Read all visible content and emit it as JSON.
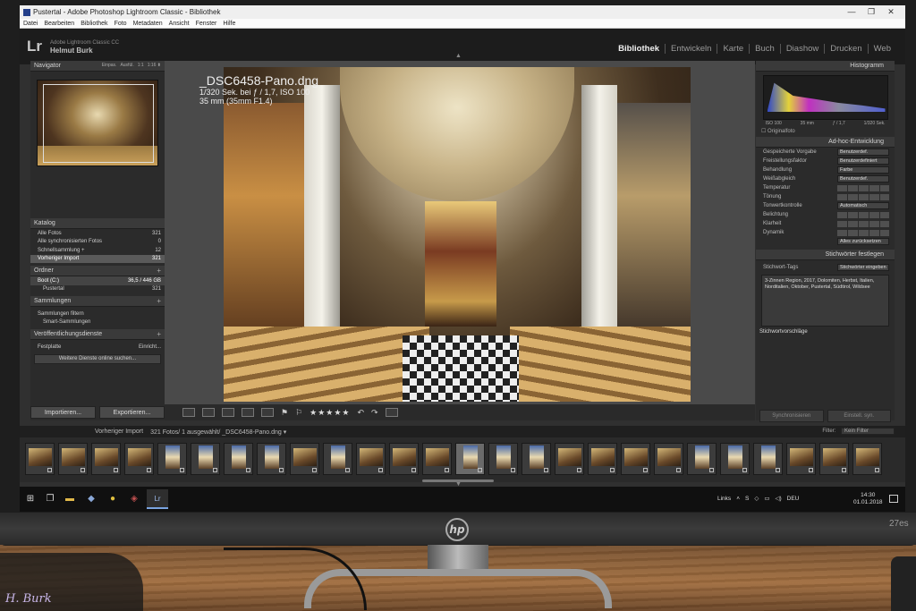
{
  "window": {
    "title": "Pustertal - Adobe Photoshop Lightroom Classic - Bibliothek",
    "controls": [
      "—",
      "❐",
      "✕"
    ],
    "menu": [
      "Datei",
      "Bearbeiten",
      "Bibliothek",
      "Foto",
      "Metadaten",
      "Ansicht",
      "Fenster",
      "Hilfe"
    ]
  },
  "identity": {
    "logo": "Lr",
    "app_name": "Adobe Lightroom Classic CC",
    "user": "Helmut Burk"
  },
  "modules": [
    "Bibliothek",
    "Entwickeln",
    "Karte",
    "Buch",
    "Diashow",
    "Drucken",
    "Web"
  ],
  "active_module": "Bibliothek",
  "left_panel": {
    "navigator": {
      "title": "Navigator",
      "zoom_options": [
        "Einpas.",
        "Ausfül.",
        "1:1",
        "1:16 ⬍"
      ]
    },
    "catalog": {
      "title": "Katalog",
      "items": [
        {
          "label": "Alle Fotos",
          "count": "321"
        },
        {
          "label": "Alle synchronisierten Fotos",
          "count": "0"
        },
        {
          "label": "Schnellsammlung +",
          "count": "12"
        },
        {
          "label": "Vorheriger Import",
          "count": "321"
        }
      ]
    },
    "folders": {
      "title": "Ordner",
      "volume": {
        "label": "Boot (C:)",
        "size": "36,5 / 446 GB"
      },
      "folder": {
        "label": "Pustertal",
        "count": "321"
      }
    },
    "collections": {
      "title": "Sammlungen",
      "filter": "Sammlungen filtern",
      "smart": "Smart-Sammlungen"
    },
    "publish": {
      "title": "Veröffentlichungsdienste",
      "disk_label": "Festplatte",
      "setup_label": "Einricht...",
      "more_services": "Weitere Dienste online suchen..."
    },
    "import_button": "Importieren...",
    "export_button": "Exportieren..."
  },
  "photo": {
    "filename": "_DSC6458-Pano.dng",
    "exposure": "1/320 Sek. bei ƒ / 1,7, ISO 100",
    "lens": "35 mm (35mm F1.4)"
  },
  "toolbar": {
    "stars": "★★★★★"
  },
  "right_panel": {
    "histogram": {
      "title": "Histogramm",
      "iso": "ISO 100",
      "focal": "35 mm",
      "aperture": "ƒ / 1,7",
      "shutter": "1/320 Sek.",
      "original": "Originalfoto"
    },
    "quick_develop": {
      "title": "Ad-hoc-Entwicklung",
      "preset_label": "Gespeicherte Vorgabe",
      "preset_value": "Benutzerdef.",
      "crop_label": "Freistellungsfaktor",
      "crop_value": "Benutzerdefiniert",
      "treatment_label": "Behandlung",
      "treatment_value": "Farbe",
      "wb_label": "Weißabgleich",
      "wb_value": "Benutzerdef.",
      "temp_label": "Temperatur",
      "tint_label": "Tönung",
      "tone_label": "Tonwertkontrolle",
      "auto_label": "Automatisch",
      "exposure_label": "Belichtung",
      "clarity_label": "Klarheit",
      "vibrance_label": "Dynamik",
      "reset_label": "Alles zurücksetzen"
    },
    "keywording": {
      "title": "Stichwörter festlegen",
      "tags_label": "Stichwort-Tags",
      "tags_mode": "Stichwörter eingeben",
      "keywords": "3-Zinnen Region, 2017, Dolomiten, Herbst, Italien, Norditalien, Oktober, Pustertal, Südtirol, Wildsee",
      "suggestions": "Stichwortvorschläge"
    },
    "sync_button": "Synchronisieren",
    "sync_settings_button": "Einstell. syn."
  },
  "filmstrip": {
    "source": "Vorheriger Import",
    "count": "321 Fotos/ 1 ausgewählt/ _DSC6458-Pano.dng ▾",
    "filter_label": "Filter:",
    "filter_value": "Kein Filter",
    "thumb_count": 26
  },
  "taskbar": {
    "links": "Links",
    "language": "DEU",
    "time": "14:30",
    "date": "01.01.2018"
  },
  "hardware": {
    "brand": "hp",
    "model": "27es"
  },
  "signature": "H. Burk"
}
